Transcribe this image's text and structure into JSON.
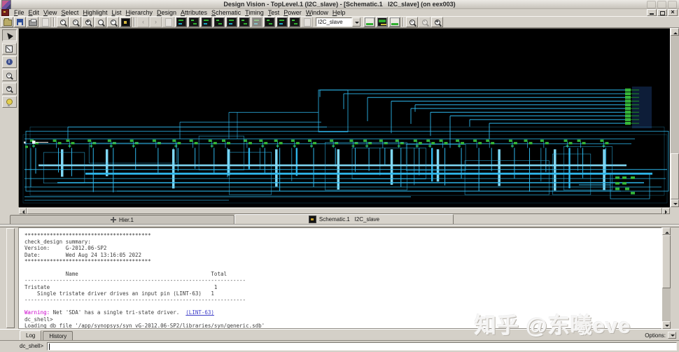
{
  "window": {
    "title": "Design Vision - TopLevel.1 (I2C_slave) - [Schematic.1   I2C_slave] (on eex003)"
  },
  "menus": [
    "File",
    "Edit",
    "View",
    "Select",
    "Highlight",
    "List",
    "Hierarchy",
    "Design",
    "Attributes",
    "Schematic",
    "Timing",
    "Test",
    "Power",
    "Window",
    "Help"
  ],
  "toolbar": {
    "design_dropdown_value": "I2C_slave",
    "icons": [
      "open-folder",
      "save-floppy",
      "printer",
      "page",
      "zoom-box",
      "zoom-out",
      "zoom-in",
      "zoom-full",
      "zoom-selected",
      "view-all-black",
      "back-arrow",
      "forward-arrow",
      "schematic-dark",
      "symbol-dark",
      "hier-dark",
      "netlist-dark",
      "filter-dark",
      "map-dark",
      "compile-dark",
      "design-list-dark",
      "layout-stripe",
      "highlight-stripe",
      "probe-stripe",
      "zoom-out-circle",
      "zoom-fit-circle",
      "zoom-in-circle"
    ]
  },
  "side_tools": [
    "select-arrow",
    "zoom-area",
    "info-circle",
    "zoom-out-magnifier",
    "zoom-in-magnifier",
    "highlight-bulb"
  ],
  "view_tabs": [
    {
      "label": "Hier.1"
    },
    {
      "label": "Schematic.1   I2C_slave"
    }
  ],
  "log": {
    "lines": [
      [
        {
          "t": "****************************************"
        }
      ],
      [
        {
          "t": "check_design summary:"
        }
      ],
      [
        {
          "t": "Version:     G-2012.06-SP2"
        }
      ],
      [
        {
          "t": "Date:        Wed Aug 24 13:16:05 2022"
        }
      ],
      [
        {
          "t": "****************************************"
        }
      ],
      [
        {
          "t": ""
        }
      ],
      [
        {
          "t": "             Name                                          Total"
        }
      ],
      [
        {
          "t": "----------------------------------------------------------------------"
        }
      ],
      [
        {
          "t": "Tristate                                                    1"
        }
      ],
      [
        {
          "t": "    Single tristate driver drives an input pin (LINT-63)   1"
        }
      ],
      [
        {
          "t": "----------------------------------------------------------------------"
        }
      ],
      [
        {
          "t": ""
        }
      ],
      [
        {
          "t": "Warning:",
          "c": "warn"
        },
        {
          "t": " Net 'SDA' has a single tri-state driver.  "
        },
        {
          "t": "(LINT-63)",
          "c": "link"
        }
      ],
      [
        {
          "t": "dc_shell>"
        }
      ],
      [
        {
          "t": "Loading db file '/app/synopsys/syn_vG-2012.06-SP2/libraries/syn/generic.sdb'"
        }
      ]
    ]
  },
  "console": {
    "tabs": [
      "Log",
      "History"
    ],
    "active_tab": "Log",
    "options_label": "Options:",
    "prompt": "dc_shell>",
    "input_value": ""
  },
  "watermark": "知乎 @东曦eve",
  "colors": {
    "wire": "#2eb6ea",
    "wire_bright": "#7fd8f5",
    "gate": "#35b83a",
    "gate_dark": "#1f8f26",
    "canvas": "#000000",
    "chrome": "#d4d0c8",
    "warning": "#cc00cc",
    "link": "#3c3cc8"
  }
}
